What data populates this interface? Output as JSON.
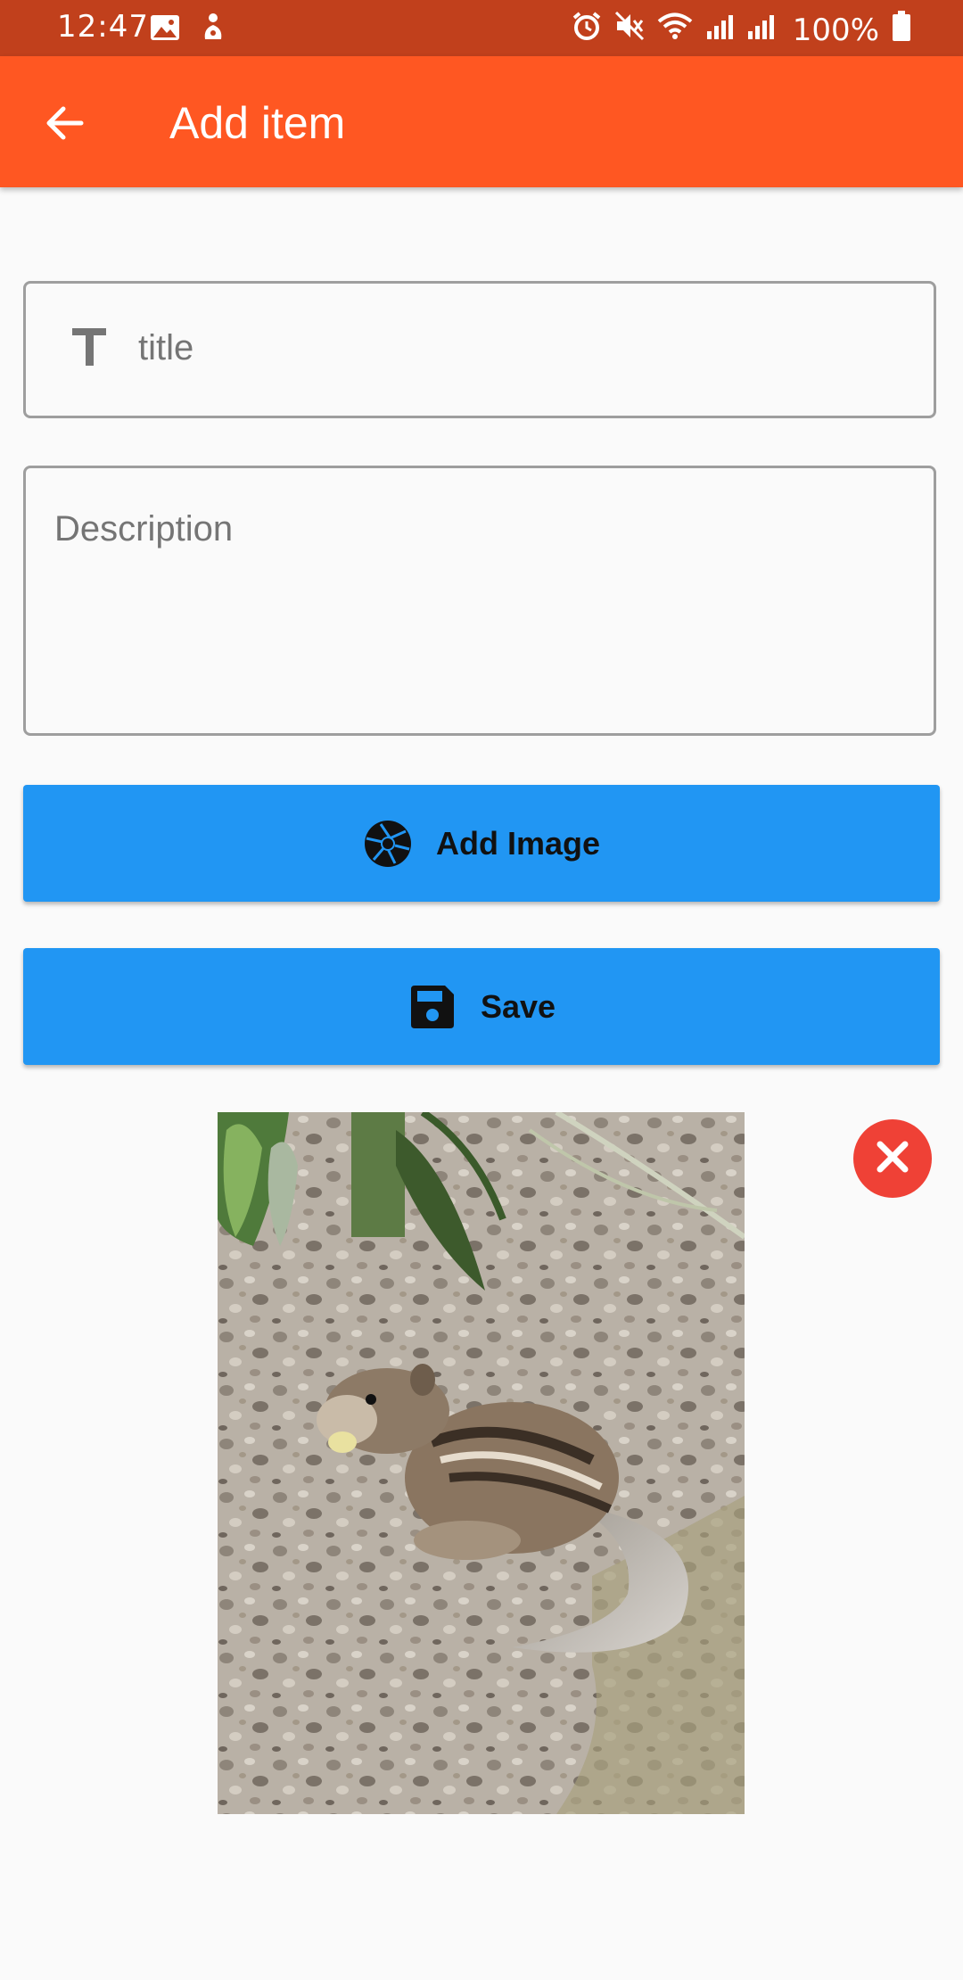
{
  "status_bar": {
    "time": "12:47",
    "battery": "100%",
    "icons": [
      "gallery-icon",
      "notification-icon",
      "alarm-icon",
      "mute-icon",
      "wifi-icon",
      "signal-icon",
      "signal-icon",
      "battery-icon"
    ]
  },
  "app_bar": {
    "title": "Add item",
    "back_icon": "arrow-back-icon"
  },
  "form": {
    "title_placeholder": "title",
    "title_value": "",
    "description_placeholder": "Description",
    "description_value": ""
  },
  "buttons": {
    "add_image_label": "Add Image",
    "save_label": "Save"
  },
  "colors": {
    "status_bar": "#c1401c",
    "app_bar": "#ff5722",
    "button": "#2196f3",
    "remove": "#ef4136",
    "background": "#fafafa"
  },
  "image": {
    "remove_icon": "close-icon"
  }
}
